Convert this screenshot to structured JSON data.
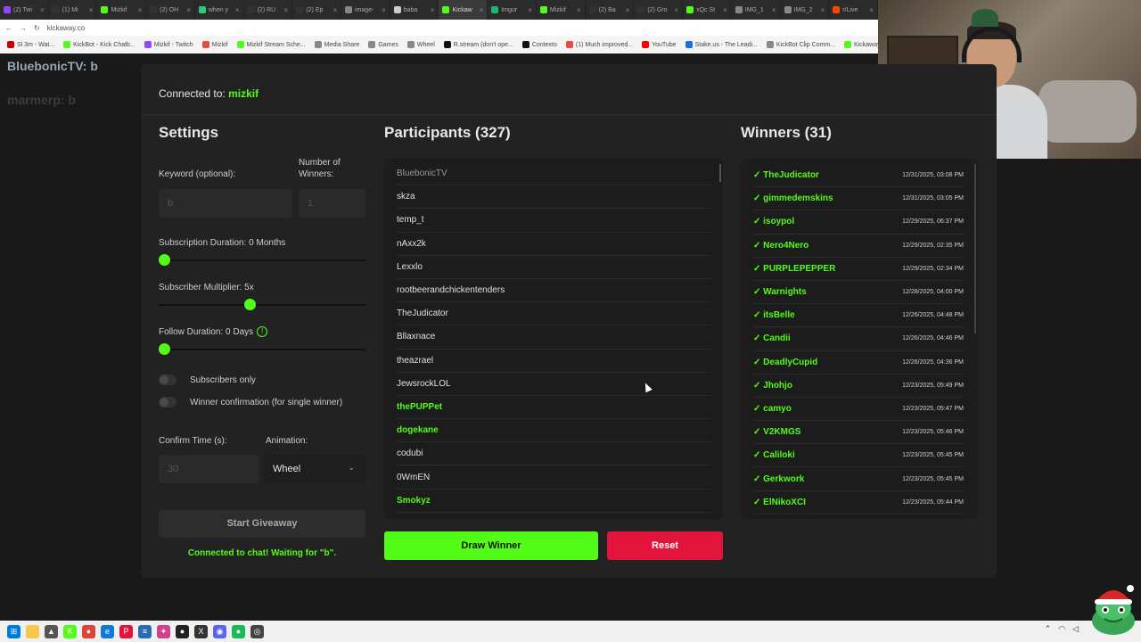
{
  "browser": {
    "tabs": [
      {
        "label": "(2) Twi",
        "color": "#9146ff"
      },
      {
        "label": "(1) Mi",
        "color": "#333333"
      },
      {
        "label": "Mizkif",
        "color": "#53fc18"
      },
      {
        "label": "(2) OH",
        "color": "#333333"
      },
      {
        "label": "when y",
        "color": "#2ecc71"
      },
      {
        "label": "(2) RU",
        "color": "#333333"
      },
      {
        "label": "(2) Ep",
        "color": "#333333"
      },
      {
        "label": "image-",
        "color": "#888888"
      },
      {
        "label": "baba",
        "color": "#cccccc"
      },
      {
        "label": "Kickaw",
        "color": "#53fc18",
        "active": true
      },
      {
        "label": "Imgur",
        "color": "#1bb76e"
      },
      {
        "label": "Mizkif",
        "color": "#53fc18"
      },
      {
        "label": "(2) Ba",
        "color": "#333333"
      },
      {
        "label": "(2) Gro",
        "color": "#333333"
      },
      {
        "label": "xQc St",
        "color": "#53fc18"
      },
      {
        "label": "IMG_1",
        "color": "#888888"
      },
      {
        "label": "IMG_2",
        "color": "#888888"
      },
      {
        "label": "r/Live",
        "color": "#ff4500"
      }
    ],
    "url": "kickaway.co",
    "bookmarks": [
      {
        "label": "Sl 3m - Wat...",
        "color": "#cc0000"
      },
      {
        "label": "KickBot - Kick Chatb...",
        "color": "#53fc18"
      },
      {
        "label": "Mizkif - Twitch",
        "color": "#9146ff"
      },
      {
        "label": "Mizkif",
        "color": "#e74c3c"
      },
      {
        "label": "Mizkif Stream Sche...",
        "color": "#53fc18"
      },
      {
        "label": "Media Share",
        "color": "#888888"
      },
      {
        "label": "Games",
        "color": "#888888"
      },
      {
        "label": "Wheel",
        "color": "#888888"
      },
      {
        "label": "R.stream (don't ope...",
        "color": "#111111"
      },
      {
        "label": "Contexto",
        "color": "#111111"
      },
      {
        "label": "(1) Much improved...",
        "color": "#e74c3c"
      },
      {
        "label": "YouTube",
        "color": "#ff0000"
      },
      {
        "label": "Stake.us - The Leadi...",
        "color": "#1b6fe0"
      },
      {
        "label": "KickBot Clip Comm...",
        "color": "#888888"
      },
      {
        "label": "Kickaway - Kick Giv...",
        "color": "#53fc18"
      }
    ]
  },
  "chat": {
    "line1": "BluebonicTV: b",
    "line2": "marmerp: b"
  },
  "app": {
    "connected_prefix": "Connected to:",
    "channel": "mizkif",
    "settings": {
      "title": "Settings",
      "keyword_label": "Keyword (optional):",
      "keyword_value": "b",
      "winners_label": "Number of Winners:",
      "winners_value": "1",
      "sub_duration_label": "Subscription Duration: 0 Months",
      "sub_duration_fraction": 0.0,
      "sub_multiplier_label": "Subscriber Multiplier: 5x",
      "sub_multiplier_fraction": 0.44,
      "follow_duration_label": "Follow Duration: 0 Days",
      "follow_duration_fraction": 0.0,
      "subscribers_only_label": "Subscribers only",
      "winner_confirm_label": "Winner confirmation (for single winner)",
      "confirm_time_label": "Confirm Time (s):",
      "confirm_time_value": "30",
      "animation_label": "Animation:",
      "animation_value": "Wheel",
      "start_button": "Start Giveaway",
      "status": "Connected to chat! Waiting for \"b\"."
    },
    "participants": {
      "title": "Participants (327)",
      "items": [
        {
          "name": "BluebonicTV",
          "style": "dim"
        },
        {
          "name": "skza",
          "style": "normal"
        },
        {
          "name": "temp_t",
          "style": "normal"
        },
        {
          "name": "nAxx2k",
          "style": "normal"
        },
        {
          "name": "Lexxlo",
          "style": "normal"
        },
        {
          "name": "rootbeerandchickentenders",
          "style": "normal"
        },
        {
          "name": "TheJudicator",
          "style": "normal"
        },
        {
          "name": "Bllaxnace",
          "style": "normal"
        },
        {
          "name": "theazrael",
          "style": "normal"
        },
        {
          "name": "JewsrockLOL",
          "style": "normal"
        },
        {
          "name": "thePUPPet",
          "style": "green"
        },
        {
          "name": "dogekane",
          "style": "green"
        },
        {
          "name": "codubi",
          "style": "normal"
        },
        {
          "name": "0WmEN",
          "style": "normal"
        },
        {
          "name": "Smokyz",
          "style": "green"
        }
      ],
      "draw_button": "Draw Winner",
      "reset_button": "Reset"
    },
    "winners": {
      "title": "Winners (31)",
      "items": [
        {
          "name": "✓ TheJudicator",
          "date": "12/31/2025, 03:08 PM"
        },
        {
          "name": "✓ gimmedemskins",
          "date": "12/31/2025, 03:05 PM"
        },
        {
          "name": "✓ isoypol",
          "date": "12/29/2025, 06:37 PM"
        },
        {
          "name": "✓ Nero4Nero",
          "date": "12/29/2025, 02:35 PM"
        },
        {
          "name": "✓ PURPLEPEPPER",
          "date": "12/29/2025, 02:34 PM"
        },
        {
          "name": "✓ Warnights",
          "date": "12/28/2025, 04:00 PM"
        },
        {
          "name": "✓ itsBelle",
          "date": "12/26/2025, 04:48 PM"
        },
        {
          "name": "✓ Candii",
          "date": "12/26/2025, 04:46 PM"
        },
        {
          "name": "✓ DeadlyCupid",
          "date": "12/26/2025, 04:36 PM"
        },
        {
          "name": "✓ Jhohjo",
          "date": "12/23/2025, 05:49 PM"
        },
        {
          "name": "✓ camyo",
          "date": "12/23/2025, 05:47 PM"
        },
        {
          "name": "✓ V2KMGS",
          "date": "12/23/2025, 05:46 PM"
        },
        {
          "name": "✓ Caliloki",
          "date": "12/23/2025, 05:45 PM"
        },
        {
          "name": "✓ Gerkwork",
          "date": "12/23/2025, 05:45 PM"
        },
        {
          "name": "✓ ElNikoXCI",
          "date": "12/23/2025, 05:44 PM"
        }
      ]
    }
  },
  "colors": {
    "accent": "#53fc18",
    "danger": "#e3143c",
    "panel": "#222222",
    "list_bg": "#1c1c1c"
  },
  "taskbar": {
    "icons": [
      {
        "name": "windows-start-icon",
        "color": "#0078d4",
        "glyph": "⊞"
      },
      {
        "name": "file-explorer-icon",
        "color": "#f2c94c",
        "glyph": ""
      },
      {
        "name": "app-icon",
        "color": "#555555",
        "glyph": "▲"
      },
      {
        "name": "kick-icon",
        "color": "#53fc18",
        "glyph": "K"
      },
      {
        "name": "chrome-icon",
        "color": "#db4437",
        "glyph": "●"
      },
      {
        "name": "edge-icon",
        "color": "#0f7bd6",
        "glyph": "e"
      },
      {
        "name": "app-red-icon",
        "color": "#e3143c",
        "glyph": "P"
      },
      {
        "name": "app-blue-icon",
        "color": "#2b6cb0",
        "glyph": "≡"
      },
      {
        "name": "app-pink-icon",
        "color": "#d53f8c",
        "glyph": "✦"
      },
      {
        "name": "app-dark-icon",
        "color": "#222222",
        "glyph": "●"
      },
      {
        "name": "app-dark2-icon",
        "color": "#333333",
        "glyph": "X"
      },
      {
        "name": "discord-icon",
        "color": "#5865f2",
        "glyph": "◉"
      },
      {
        "name": "spotify-icon",
        "color": "#1db954",
        "glyph": "●"
      },
      {
        "name": "obs-icon",
        "color": "#444444",
        "glyph": "◎"
      }
    ]
  }
}
